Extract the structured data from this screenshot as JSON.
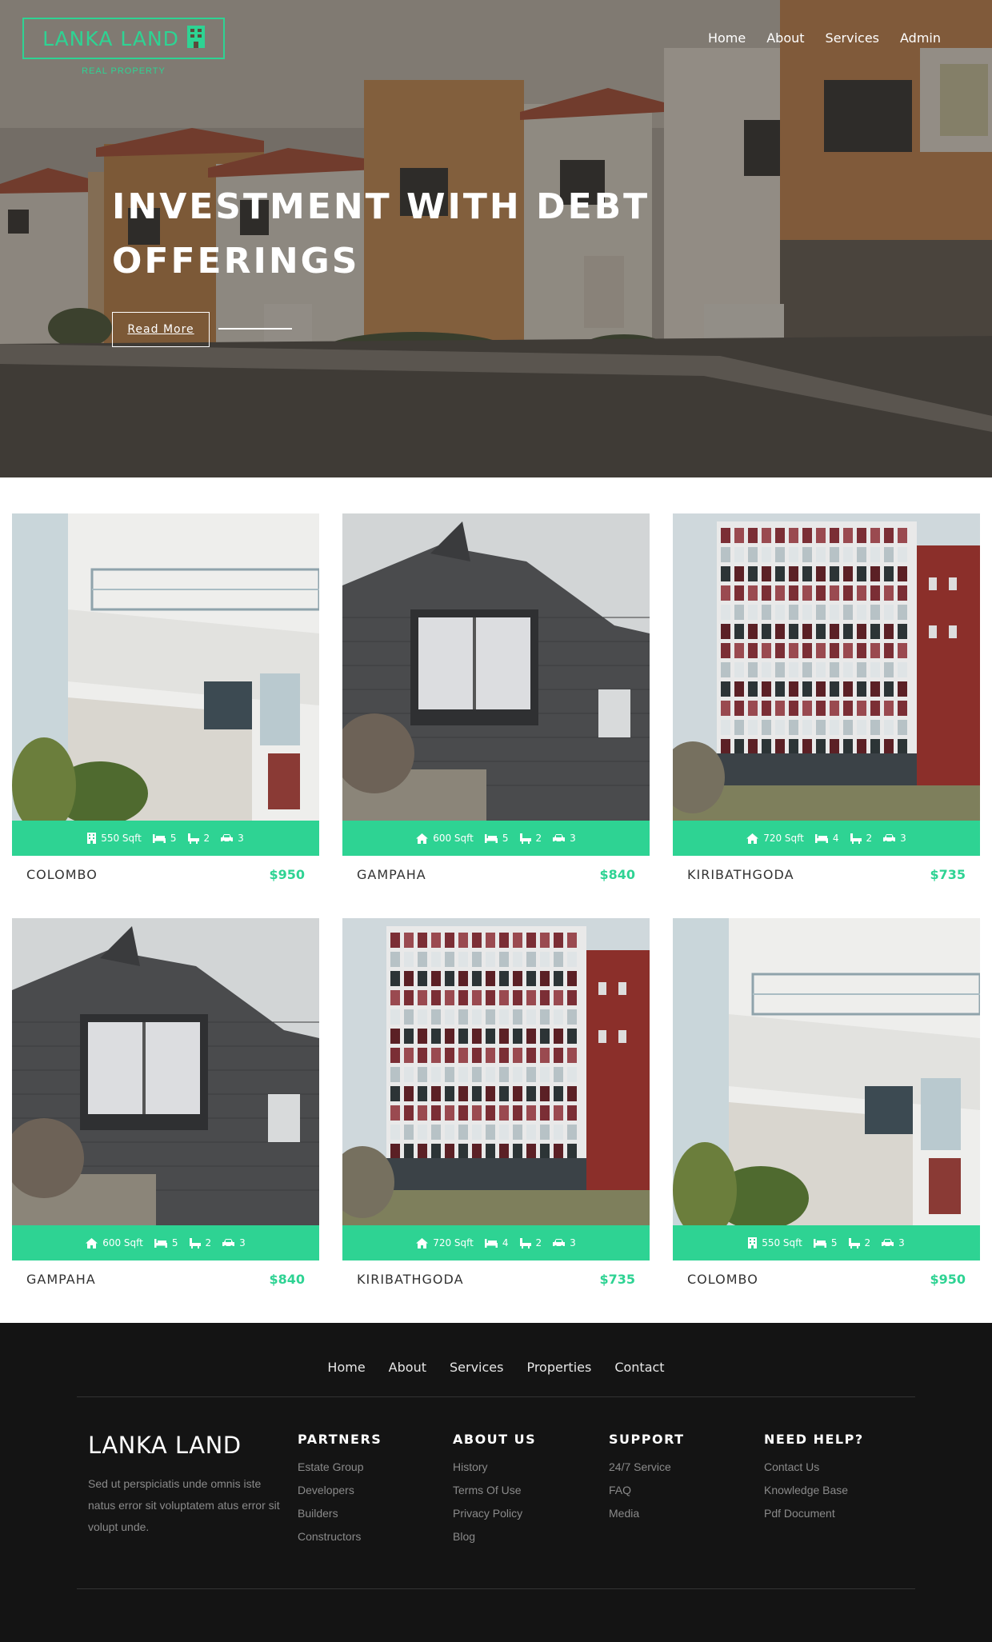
{
  "brand": {
    "logo_text": "LANKA LAND",
    "logo_subtitle": "REAL PROPERTY",
    "accent_color": "#2ed393"
  },
  "nav": {
    "items": [
      {
        "label": "Home"
      },
      {
        "label": "About"
      },
      {
        "label": "Services"
      },
      {
        "label": "Admin"
      }
    ]
  },
  "hero": {
    "title": "INVESTMENT WITH DEBT OFFERINGS",
    "cta_label": "Read More"
  },
  "icons": {
    "area_icons": [
      "building-icon",
      "home-icon"
    ],
    "bed": "bed-icon",
    "bath": "bath-icon",
    "car": "car-icon"
  },
  "listings": [
    {
      "city": "COLOMBO",
      "price": "$950",
      "area": "550 Sqft",
      "area_icon": "building-icon",
      "beds": "5",
      "baths": "2",
      "cars": "3"
    },
    {
      "city": "GAMPAHA",
      "price": "$840",
      "area": "600 Sqft",
      "area_icon": "home-icon",
      "beds": "5",
      "baths": "2",
      "cars": "3"
    },
    {
      "city": "KIRIBATHGODA",
      "price": "$735",
      "area": "720 Sqft",
      "area_icon": "home-icon",
      "beds": "4",
      "baths": "2",
      "cars": "3"
    },
    {
      "city": "GAMPAHA",
      "price": "$840",
      "area": "600 Sqft",
      "area_icon": "home-icon",
      "beds": "5",
      "baths": "2",
      "cars": "3"
    },
    {
      "city": "KIRIBATHGODA",
      "price": "$735",
      "area": "720 Sqft",
      "area_icon": "home-icon",
      "beds": "4",
      "baths": "2",
      "cars": "3"
    },
    {
      "city": "COLOMBO",
      "price": "$950",
      "area": "550 Sqft",
      "area_icon": "building-icon",
      "beds": "5",
      "baths": "2",
      "cars": "3"
    }
  ],
  "footer": {
    "nav": [
      {
        "label": "Home"
      },
      {
        "label": "About"
      },
      {
        "label": "Services"
      },
      {
        "label": "Properties"
      },
      {
        "label": "Contact"
      }
    ],
    "brand": "LANKA LAND",
    "description": "Sed ut perspiciatis unde omnis iste natus error sit voluptatem atus error sit volupt unde.",
    "columns": [
      {
        "title": "PARTNERS",
        "links": [
          "Estate Group",
          "Developers",
          "Builders",
          "Constructors"
        ]
      },
      {
        "title": "ABOUT US",
        "links": [
          "History",
          "Terms Of Use",
          "Privacy Policy",
          "Blog"
        ]
      },
      {
        "title": "SUPPORT",
        "links": [
          "24/7 Service",
          "FAQ",
          "Media"
        ]
      },
      {
        "title": "NEED HELP?",
        "links": [
          "Contact Us",
          "Knowledge Base",
          "Pdf Document"
        ]
      }
    ]
  }
}
